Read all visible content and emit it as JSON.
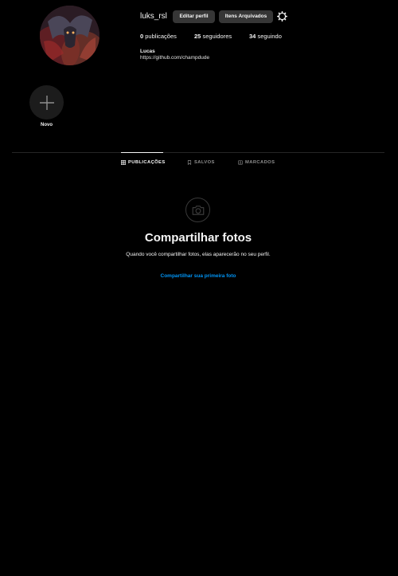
{
  "profile": {
    "username": "luks_rsl",
    "edit_button": "Editar perfil",
    "archive_button": "Itens Arquivados",
    "settings_icon": "gear-icon",
    "stats": {
      "posts_count": "0",
      "posts_label": "publicações",
      "followers_count": "25",
      "followers_label": "seguidores",
      "following_count": "34",
      "following_label": "seguindo"
    },
    "bio": {
      "name": "Lucas",
      "link": "https://github.com/champdude"
    }
  },
  "highlights": {
    "new_label": "Novo",
    "new_icon": "plus-icon"
  },
  "tabs": [
    {
      "label": "PUBLICAÇÕES",
      "icon": "grid-icon",
      "active": true
    },
    {
      "label": "SALVOS",
      "icon": "bookmark-icon",
      "active": false
    },
    {
      "label": "MARCADOS",
      "icon": "tag-icon",
      "active": false
    }
  ],
  "empty_state": {
    "icon": "camera-icon",
    "title": "Compartilhar fotos",
    "description": "Quando você compartilhar fotos, elas aparecerão no seu perfil.",
    "cta": "Compartilhar sua primeira foto"
  },
  "colors": {
    "background": "#000000",
    "button_bg": "#363636",
    "link_blue": "#0095f6",
    "muted_text": "#8e8e8e"
  }
}
